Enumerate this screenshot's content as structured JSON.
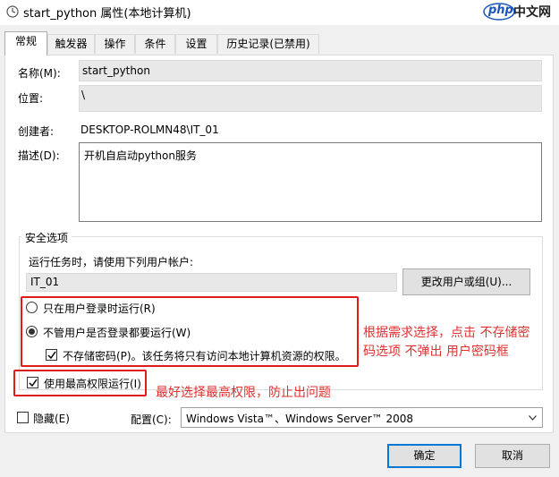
{
  "window": {
    "title": "start_python 属性(本地计算机)",
    "logo_text": "php",
    "logo_cn": "中文网"
  },
  "tabs": [
    {
      "label": "常规",
      "active": true
    },
    {
      "label": "触发器"
    },
    {
      "label": "操作"
    },
    {
      "label": "条件"
    },
    {
      "label": "设置"
    },
    {
      "label": "历史记录(已禁用)"
    }
  ],
  "general": {
    "name_label": "名称(M):",
    "name_value": "start_python",
    "location_label": "位置:",
    "location_value": "\\",
    "author_label": "创建者:",
    "author_value": "DESKTOP-ROLMN48\\IT_01",
    "description_label": "描述(D):",
    "description_value": "开机自启动python服务"
  },
  "security": {
    "group_label": "安全选项",
    "run_as_prompt": "运行任务时，请使用下列用户帐户:",
    "user_account": "IT_01",
    "change_user_button": "更改用户或组(U)...",
    "radio_logged_on": "只在用户登录时运行(R)",
    "radio_logged_on_selected": false,
    "radio_whether_logged": "不管用户是否登录都要运行(W)",
    "radio_whether_logged_selected": true,
    "no_store_password": "不存储密码(P)。该任务将只有访问本地计算机资源的权限。",
    "no_store_password_checked": true,
    "highest_privileges": "使用最高权限运行(I)",
    "highest_privileges_checked": true
  },
  "annotations": {
    "note1_line1": "根据需求选择，点击 不存储密",
    "note1_line2": "码选项 不弹出 用户密码框",
    "note2": "最好选择最高权限，防止出问题",
    "color": "#e01b1b"
  },
  "bottom": {
    "hidden_label": "隐藏(E)",
    "hidden_checked": false,
    "configure_label": "配置(C):",
    "configure_value": "Windows Vista™、Windows Server™ 2008"
  },
  "buttons": {
    "ok": "确定",
    "cancel": "取消"
  },
  "colors": {
    "accent": "#0078d7",
    "annotation_red": "#e01b1b"
  }
}
